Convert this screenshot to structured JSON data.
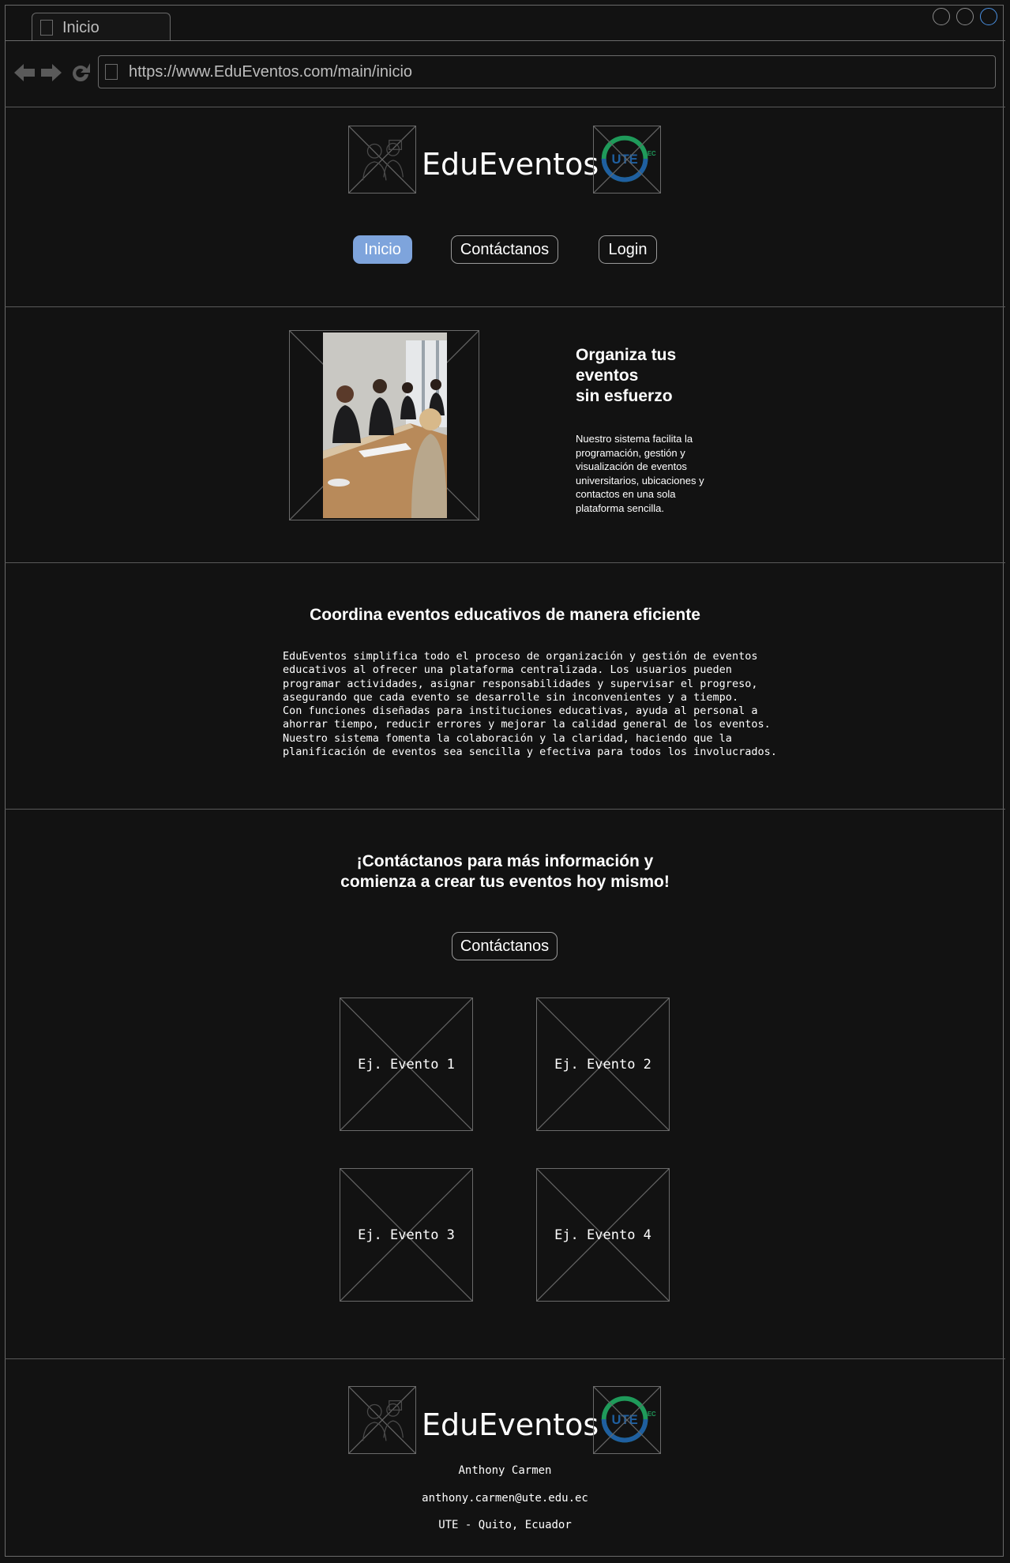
{
  "browser": {
    "tab_title": "Inicio",
    "url": "https://www.EduEventos.com/main/inicio"
  },
  "header": {
    "brand": "EduEventos",
    "nav": [
      "Inicio",
      "Contáctanos",
      "Login"
    ],
    "active_nav": "Inicio",
    "accent_color": "#7ea4dc"
  },
  "hero": {
    "title_lines": [
      "Organiza tus",
      "eventos",
      "sin esfuerzo"
    ],
    "description_lines": [
      "Nuestro sistema facilita la",
      "programación, gestión y",
      "visualización de eventos",
      "universitarios, ubicaciones y",
      "contactos en una sola",
      "plataforma sencilla."
    ]
  },
  "about": {
    "title": "Coordina eventos educativos de manera eficiente",
    "lines": [
      "EduEventos simplifica todo el proceso de organización y gestión de eventos",
      "educativos al ofrecer una plataforma centralizada. Los usuarios pueden",
      "programar actividades, asignar responsabilidades y supervisar el progreso,",
      "asegurando que cada evento se desarrolle sin inconvenientes y a tiempo.",
      "Con funciones diseñadas para instituciones educativas, ayuda al personal a",
      "ahorrar tiempo, reducir errores y mejorar la calidad general de los eventos.",
      "Nuestro sistema fomenta la colaboración y la claridad, haciendo que la",
      "planificación de eventos sea sencilla y efectiva para todos los involucrados."
    ]
  },
  "cta": {
    "title_lines": [
      "¡Contáctanos para más información y",
      "comienza a crear tus eventos hoy mismo!"
    ],
    "button": "Contáctanos"
  },
  "events": [
    "Ej. Evento 1",
    "Ej. Evento 2",
    "Ej. Evento 3",
    "Ej. Evento 4"
  ],
  "footer": {
    "brand": "EduEventos",
    "name": "Anthony Carmen",
    "email": "anthony.carmen@ute.edu.ec",
    "location": "UTE - Quito, Ecuador"
  },
  "icons": {
    "logo_left": "people-logo-icon",
    "logo_right": "ute-ec-logo-icon"
  }
}
